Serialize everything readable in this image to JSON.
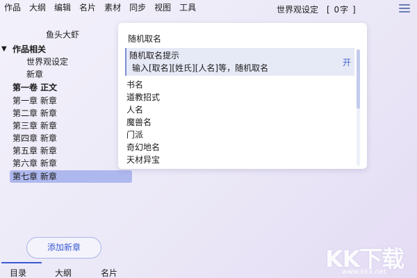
{
  "menu": [
    "作品",
    "大纲",
    "编辑",
    "名片",
    "素材",
    "同步",
    "视图",
    "工具"
  ],
  "header": {
    "doc_title": "世界观设定",
    "word_count": "[ 0字 ]"
  },
  "sidebar": {
    "book_title": "鱼头大虾",
    "group_label": "作品相关",
    "group_toggle": "▼",
    "group_items": [
      "世界观设定",
      "新章"
    ],
    "volume_label": "第一卷 正文",
    "chapters": [
      "第一章 新章",
      "第二章 新章",
      "第三章 新章",
      "第四章 新章",
      "第五章 新章",
      "第六章 新章",
      "第七章 新章"
    ],
    "selected_chapter_index": 6,
    "add_button": "添加新章"
  },
  "tabs": [
    "目录",
    "大纲",
    "名片"
  ],
  "active_tab_index": 0,
  "popup": {
    "header": "随机取名",
    "hint_title": "随机取名提示",
    "hint_desc": "输入[取名][姓氏][人名]等，随机取名",
    "hint_toggle": "开",
    "items": [
      "书名",
      "道教招式",
      "人名",
      "魔兽名",
      "门派",
      "奇幻地名",
      "天材异宝"
    ]
  },
  "watermark": {
    "text": "KK下载",
    "url": "www.kkx.net"
  },
  "colors": {
    "accent": "#3a5bd0",
    "selected_row": "#aeb8ee",
    "hint_bg": "#e6e9f6"
  },
  "icons": {
    "menu": "hamburger-icon",
    "collapse": "chevron-down-icon"
  }
}
